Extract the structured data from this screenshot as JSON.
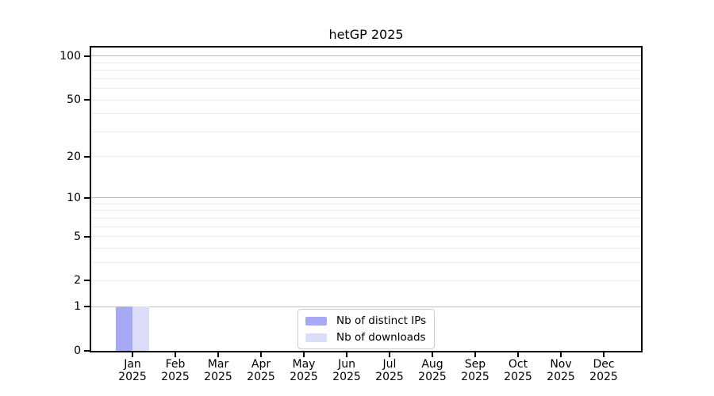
{
  "chart_data": {
    "type": "bar",
    "title": "hetGP 2025",
    "categories": [
      "Jan",
      "Feb",
      "Mar",
      "Apr",
      "May",
      "Jun",
      "Jul",
      "Aug",
      "Sep",
      "Oct",
      "Nov",
      "Dec"
    ],
    "category_year": "2025",
    "series": [
      {
        "name": "Nb of distinct IPs",
        "color": "#a8a9f4",
        "values": [
          1,
          0,
          0,
          0,
          0,
          0,
          0,
          0,
          0,
          0,
          0,
          0
        ]
      },
      {
        "name": "Nb of downloads",
        "color": "#dcddf9",
        "values": [
          1,
          0,
          0,
          0,
          0,
          0,
          0,
          0,
          0,
          0,
          0,
          0
        ]
      }
    ],
    "xlabel": "",
    "ylabel": "",
    "y_axis": {
      "scale": "log1p",
      "tick_values": [
        0,
        1,
        2,
        5,
        10,
        20,
        50,
        100
      ],
      "major_grid_values": [
        1,
        10,
        100
      ],
      "minor_grid_values": [
        2,
        3,
        4,
        5,
        6,
        7,
        8,
        9,
        20,
        30,
        40,
        50,
        60,
        70,
        80,
        90
      ],
      "range_top": 114.7,
      "ylim_labeled": [
        0,
        100
      ]
    },
    "legend": {
      "position": "bottom-center"
    },
    "grid": true,
    "colors": {
      "major_grid": "#c0c0c0",
      "minor_grid": "#ececec",
      "spine": "#000000",
      "background": "#ffffff",
      "legend_border": "#cccccc"
    }
  }
}
